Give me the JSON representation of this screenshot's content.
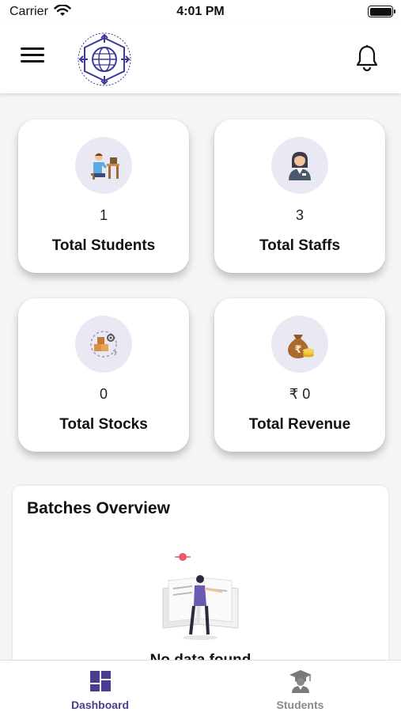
{
  "status_bar": {
    "carrier": "Carrier",
    "time": "4:01 PM"
  },
  "header": {
    "menu_icon": "hamburger-menu-icon",
    "logo_icon": "institute-logo-icon",
    "bell_icon": "bell-icon"
  },
  "stats": [
    {
      "value": "1",
      "label": "Total Students",
      "icon": "student-desk-icon"
    },
    {
      "value": "3",
      "label": "Total Staffs",
      "icon": "staff-person-icon"
    },
    {
      "value": "0",
      "label": "Total Stocks",
      "icon": "stock-boxes-icon"
    },
    {
      "value": "₹ 0",
      "label": "Total Revenue",
      "icon": "money-bag-icon"
    }
  ],
  "batches": {
    "title": "Batches Overview",
    "empty_text": "No data found",
    "illustration": "empty-book-illustration"
  },
  "tabs": [
    {
      "label": "Dashboard",
      "icon": "dashboard-grid-icon",
      "active": true
    },
    {
      "label": "Students",
      "icon": "graduate-icon",
      "active": false
    }
  ],
  "colors": {
    "accent": "#4a3f8f",
    "icon_bg": "#e9e8f3",
    "inactive": "#8a8a8a"
  }
}
